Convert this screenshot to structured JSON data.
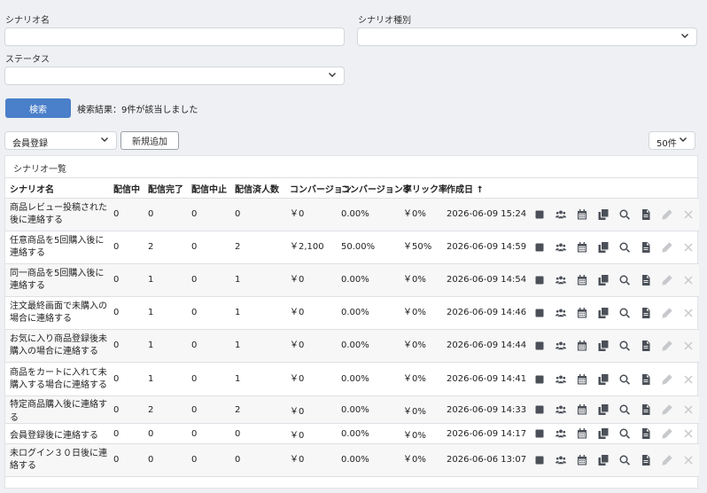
{
  "search": {
    "scenario_name_label": "シナリオ名",
    "scenario_name_value": "",
    "scenario_type_label": "シナリオ種別",
    "scenario_type_value": "",
    "status_label": "ステータス",
    "status_value": "",
    "search_button": "検索",
    "result_text": "検索結果：9件が該当しました"
  },
  "toolbar": {
    "category_select": "会員登録",
    "new_button": "新規追加",
    "per_page": "50件"
  },
  "list": {
    "title": "シナリオ一覧",
    "headers": [
      "シナリオ名",
      "配信中",
      "配信完了",
      "配信中止",
      "配信済人数",
      "コンバージョン",
      "コンバージョン率",
      "クリック率",
      "作成日 ↑"
    ],
    "rows": [
      {
        "name": "商品レビュー投稿された後に連絡する",
        "active": "0",
        "done": "0",
        "stopped": "0",
        "sent": "0",
        "conv": "￥0",
        "conv_rate": "0.00%",
        "click": "￥0%",
        "created": "2026-06-09 15:24"
      },
      {
        "name": "任意商品を5回購入後に連絡する",
        "active": "0",
        "done": "2",
        "stopped": "0",
        "sent": "2",
        "conv": "￥2,100",
        "conv_rate": "50.00%",
        "click": "￥50%",
        "created": "2026-06-09 14:59"
      },
      {
        "name": "同一商品を5回購入後に連絡する",
        "active": "0",
        "done": "1",
        "stopped": "0",
        "sent": "1",
        "conv": "￥0",
        "conv_rate": "0.00%",
        "click": "￥0%",
        "created": "2026-06-09 14:54"
      },
      {
        "name": "注文最終画面で未購入の場合に連絡する",
        "active": "0",
        "done": "1",
        "stopped": "0",
        "sent": "1",
        "conv": "￥0",
        "conv_rate": "0.00%",
        "click": "￥0%",
        "created": "2026-06-09 14:46"
      },
      {
        "name": "お気に入り商品登録後未購入の場合に連絡する",
        "active": "0",
        "done": "1",
        "stopped": "0",
        "sent": "1",
        "conv": "￥0",
        "conv_rate": "0.00%",
        "click": "￥0%",
        "created": "2026-06-09 14:44"
      },
      {
        "name": "商品をカートに入れて未購入する場合に連絡する",
        "active": "0",
        "done": "1",
        "stopped": "0",
        "sent": "1",
        "conv": "￥0",
        "conv_rate": "0.00%",
        "click": "￥0%",
        "created": "2026-06-09 14:41"
      },
      {
        "name": "特定商品購入後に連絡する",
        "active": "0",
        "done": "2",
        "stopped": "0",
        "sent": "2",
        "conv": "￥0",
        "conv_rate": "0.00%",
        "click": "￥0%",
        "created": "2026-06-09 14:33"
      },
      {
        "name": "会員登録後に連絡する",
        "active": "0",
        "done": "0",
        "stopped": "0",
        "sent": "0",
        "conv": "￥0",
        "conv_rate": "0.00%",
        "click": "￥0%",
        "created": "2026-06-09 14:17"
      },
      {
        "name": "未ログイン３０日後に連絡する",
        "active": "0",
        "done": "0",
        "stopped": "0",
        "sent": "0",
        "conv": "￥0",
        "conv_rate": "0.00%",
        "click": "￥0%",
        "created": "2026-06-06 13:07"
      }
    ],
    "row_actions": [
      "stop-icon",
      "users-icon",
      "calendar-icon",
      "copy-icon",
      "search-icon",
      "document-icon",
      "edit-icon",
      "delete-icon"
    ]
  },
  "colors": {
    "primary": "#4a7fc9",
    "icon": "#4b5058",
    "icon_disabled": "#c7c9cc",
    "background": "#eef0f3"
  }
}
